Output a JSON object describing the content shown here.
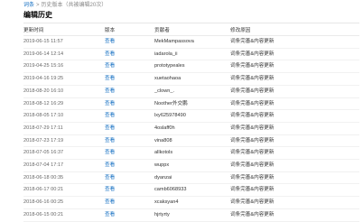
{
  "breadcrumb": {
    "home": "词条",
    "separator": ">",
    "current": "历史版本",
    "note": "（共被编辑20次）"
  },
  "page_title": "编辑历史",
  "table": {
    "headers": [
      "更新时间",
      "版本",
      "贡献者",
      "修改原因"
    ],
    "rows": [
      {
        "time": "2019-06-15 11:57",
        "version": "查看",
        "contributor": "MekMampassova",
        "reason": "词条完善&内容更新"
      },
      {
        "time": "2019-06-14 12:14",
        "version": "查看",
        "contributor": "iadarola_ii",
        "reason": "词条完善&内容更新"
      },
      {
        "time": "2019-04-25 15:16",
        "version": "查看",
        "contributor": "prototypeales",
        "reason": "词条完善&内容更新"
      },
      {
        "time": "2019-04-16 19:25",
        "version": "查看",
        "contributor": "xuetaohaoa",
        "reason": "词条完善&内容更新"
      },
      {
        "time": "2018-08-20 16:10",
        "version": "查看",
        "contributor": "_clown_.",
        "reason": "词条完善&内容更新"
      },
      {
        "time": "2018-08-12 16:29",
        "version": "查看",
        "contributor": "Noother外交鹏",
        "reason": "词条完善&内容更新"
      },
      {
        "time": "2018-08-05 17:10",
        "version": "查看",
        "contributor": "lxy625978490",
        "reason": "词条完善&内容更新"
      },
      {
        "time": "2018-07-29 17:11",
        "version": "查看",
        "contributor": "4oslaff0h",
        "reason": "词条完善&内容更新"
      },
      {
        "time": "2018-07-23 17:19",
        "version": "查看",
        "contributor": "vina808",
        "reason": "词条完善&内容更新"
      },
      {
        "time": "2018-07-05 16:37",
        "version": "查看",
        "contributor": "allkotols",
        "reason": "词条完善&内容更新"
      },
      {
        "time": "2018-07-04 17:17",
        "version": "查看",
        "contributor": "wuppx",
        "reason": "词条完善&内容更新"
      },
      {
        "time": "2018-06-18 00:35",
        "version": "查看",
        "contributor": "dyanzai",
        "reason": "词条完善&内容更新"
      },
      {
        "time": "2018-06-17 00:21",
        "version": "查看",
        "contributor": "camb6068933",
        "reason": "词条完善&内容更新"
      },
      {
        "time": "2018-06-16 00:25",
        "version": "查看",
        "contributor": "xcaksyan4",
        "reason": "词条完善&内容更新"
      },
      {
        "time": "2018-06-15 00:21",
        "version": "查看",
        "contributor": "hjrtyrty",
        "reason": "词条完善&内容更新"
      }
    ]
  }
}
